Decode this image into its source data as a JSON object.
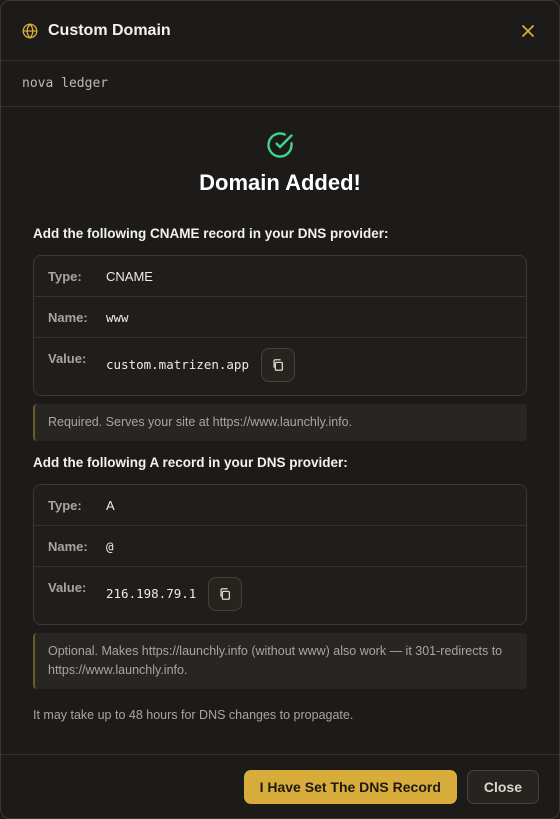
{
  "dialog": {
    "title": "Custom Domain",
    "project_name": "nova ledger"
  },
  "success": {
    "title": "Domain Added!"
  },
  "cname": {
    "instruction": "Add the following CNAME record in your DNS provider:",
    "type_label": "Type:",
    "type_value": "CNAME",
    "name_label": "Name:",
    "name_value": "www",
    "value_label": "Value:",
    "value_value": "custom.matrizen.app",
    "note": "Required. Serves your site at https://www.launchly.info."
  },
  "a_record": {
    "instruction": "Add the following A record in your DNS provider:",
    "type_label": "Type:",
    "type_value": "A",
    "name_label": "Name:",
    "name_value": "@",
    "value_label": "Value:",
    "value_value": "216.198.79.1",
    "note": "Optional. Makes https://launchly.info (without www) also work — it 301-redirects to https://www.launchly.info."
  },
  "footnote": "It may take up to 48 hours for DNS changes to propagate.",
  "footer": {
    "primary_label": "I Have Set The DNS Record",
    "secondary_label": "Close"
  },
  "colors": {
    "accent": "#d8ac3a",
    "success": "#3ed68f",
    "background": "#1c1b19"
  },
  "icons": {
    "header": "globe-icon",
    "close": "close-icon",
    "success": "check-circle-icon",
    "copy": "copy-icon"
  }
}
